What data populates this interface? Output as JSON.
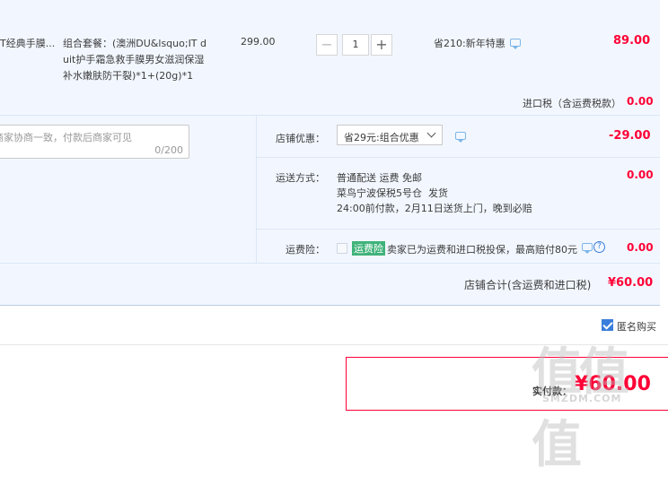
{
  "item": {
    "title_line1": "T经典手膜...",
    "package_line1": "组合套餐：(澳洲DU&lsquo;IT d",
    "package_line2": "uit护手霜急救手膜男女滋润保湿",
    "package_line3": "补水嫩肤防干裂)*1+(20g)*1",
    "price": "299.00",
    "quantity": "1",
    "minus_label": "−",
    "plus_label": "+",
    "discount": "省210:新年特惠",
    "subtotal": "89.00"
  },
  "import_tax": {
    "label": "进口税（含运费税款）",
    "value": "0.00"
  },
  "memo": {
    "placeholder": "商家协商一致，付款后商家可见",
    "counter": "0/200"
  },
  "store_discount": {
    "label": "店铺优惠：",
    "selected": "省29元:组合优惠",
    "value": "-29.00"
  },
  "shipping": {
    "label": "运送方式：",
    "line1": "普通配送 运费 免邮",
    "line2_a": "菜鸟宁波保税5号仓",
    "line2_b": "发货",
    "line3": "24:00前付款，2月11日送货上门，晚到必赔",
    "value": "0.00"
  },
  "insurance": {
    "label": "运费险：",
    "tag": "运费险",
    "text": "卖家已为运费和进口税投保，最高赔付80元",
    "help": "?",
    "value": "0.00"
  },
  "store_total": {
    "label": "店铺合计(含运费和进口税)",
    "value": "¥60.00"
  },
  "anonymous": {
    "label": "匿名购买"
  },
  "payment": {
    "label": "实付款：",
    "value": "¥60.00"
  },
  "watermark": "值值值",
  "watermark_sub": "SMZDM.COM",
  "colors": {
    "accent_red": "#ff0036",
    "panel_bg": "#f2f7ff",
    "tag_green": "#3fb37a",
    "checkbox_blue": "#3a7ddb"
  }
}
